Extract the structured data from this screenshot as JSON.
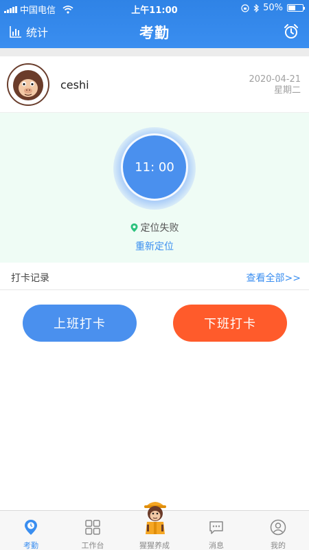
{
  "status_bar": {
    "carrier": "中国电信",
    "time": "上午11:00",
    "battery": "50%",
    "battery_level": 0.5
  },
  "nav": {
    "stats_label": "统计",
    "title": "考勤",
    "stats_icon": "bar-chart-icon",
    "right_icon": "alarm-clock-icon"
  },
  "profile": {
    "username": "ceshi",
    "date": "2020-04-21",
    "weekday": "星期二"
  },
  "clock": {
    "time": "11: 00",
    "location_status": "定位失败",
    "relocate_label": "重新定位"
  },
  "records": {
    "label": "打卡记录",
    "view_all": "查看全部>>"
  },
  "actions": {
    "clock_in": "上班打卡",
    "clock_out": "下班打卡"
  },
  "tabs": [
    {
      "label": "考勤",
      "icon": "clock-pin-icon",
      "active": true
    },
    {
      "label": "工作台",
      "icon": "grid-icon",
      "active": false
    },
    {
      "label": "猩猩养成",
      "icon": "mascot-icon",
      "active": false
    },
    {
      "label": "消息",
      "icon": "message-icon",
      "active": false
    },
    {
      "label": "我的",
      "icon": "profile-icon",
      "active": false
    }
  ],
  "colors": {
    "primary": "#3a8ef0",
    "clock_out": "#ff5b2b",
    "clock_area_bg": "#effcf5"
  }
}
